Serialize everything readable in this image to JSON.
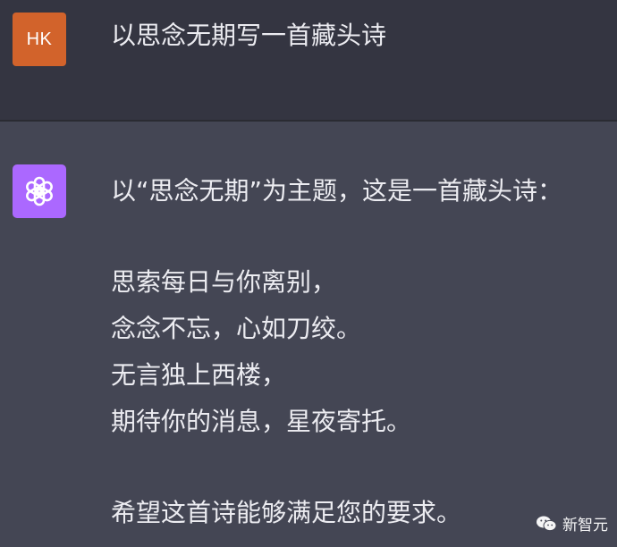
{
  "colors": {
    "user_bg": "#343541",
    "assistant_bg": "#444654",
    "user_avatar": "#d2632b",
    "bot_avatar": "#ab68ff",
    "text": "#ececf1"
  },
  "user": {
    "avatar_initials": "HK",
    "message": "以思念无期写一首藏头诗"
  },
  "assistant": {
    "avatar_icon": "openai-logo-icon",
    "intro": "以“思念无期”为主题，这是一首藏头诗：",
    "poem_lines": [
      "思索每日与你离别，",
      "念念不忘，心如刀绞。",
      "无言独上西楼，",
      "期待你的消息，星夜寄托。"
    ],
    "closing": "希望这首诗能够满足您的要求。"
  },
  "watermark": {
    "icon": "wechat-icon",
    "text": "新智元"
  }
}
